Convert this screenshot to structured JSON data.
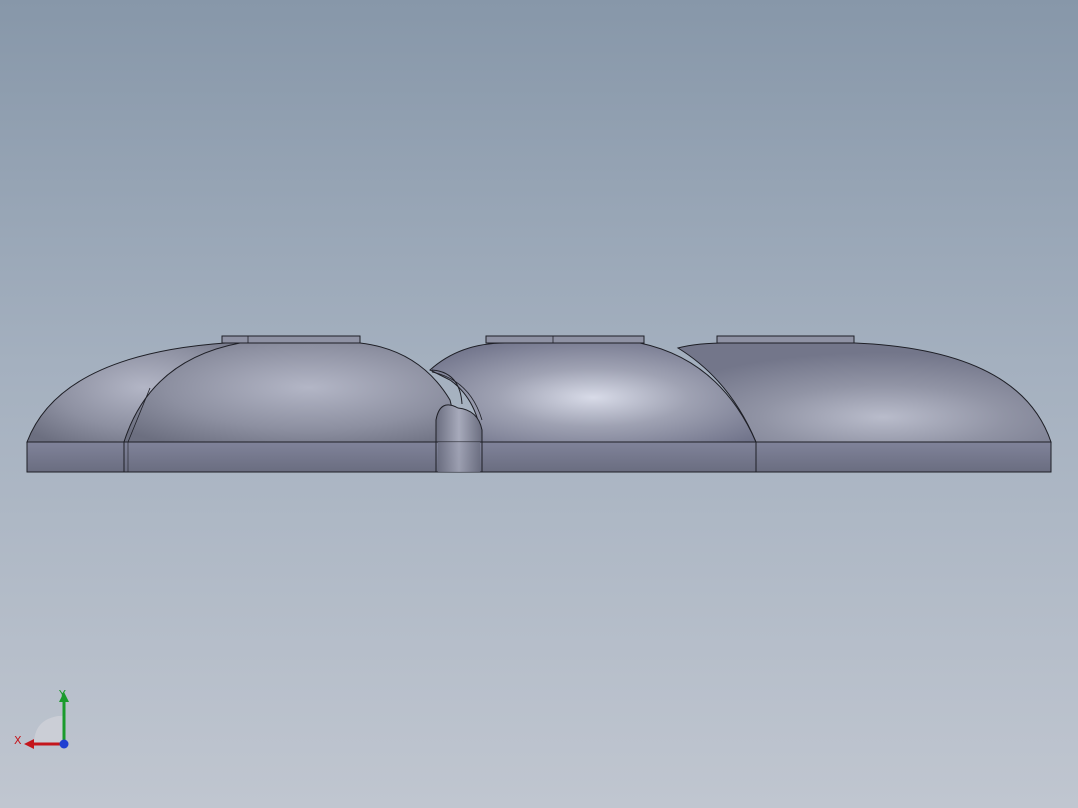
{
  "viewport": {
    "background_top": "#8797a9",
    "background_bottom": "#c0c6d0"
  },
  "model": {
    "body_color": "#8a8d9e",
    "edge_color": "#1e1f26",
    "highlight_color": "#d6d9e6"
  },
  "triad": {
    "x_label": "X",
    "y_label": "Y",
    "x_color": "#c4161c",
    "y_color": "#1a9b2c",
    "z_color": "#1f3fd1"
  }
}
